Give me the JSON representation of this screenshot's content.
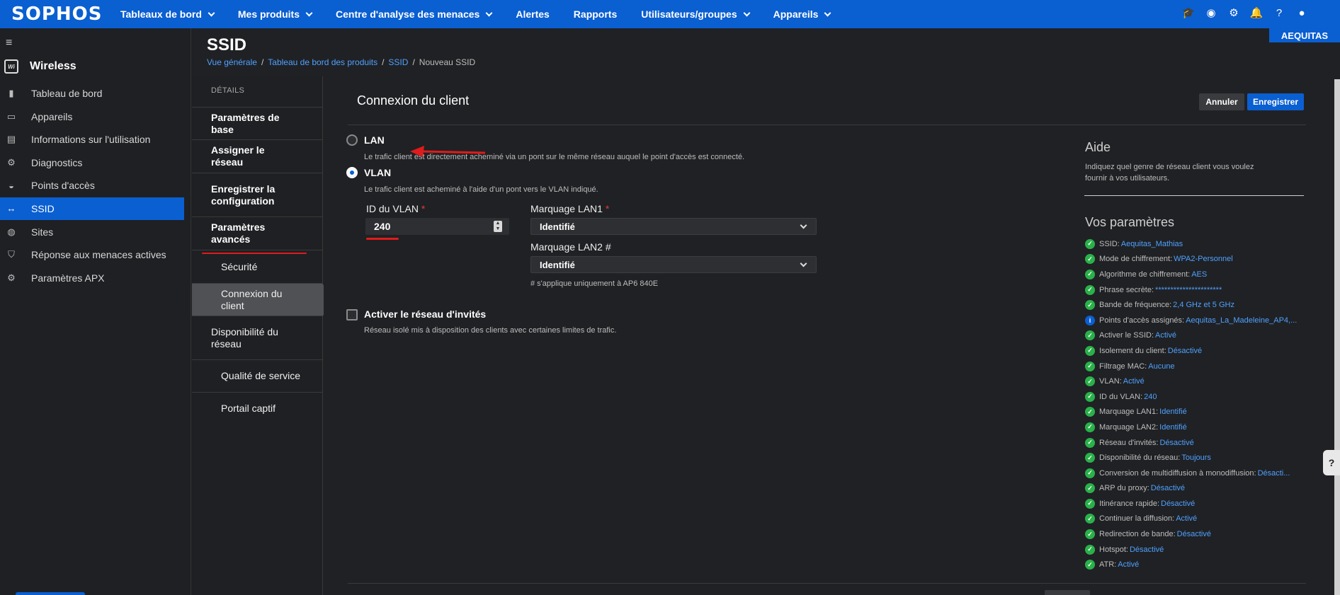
{
  "brand": {
    "logo": "SOPHOS",
    "tenant": "AEQUITAS"
  },
  "topnav": [
    {
      "label": "Tableaux de bord",
      "dropdown": true
    },
    {
      "label": "Mes produits",
      "dropdown": true
    },
    {
      "label": "Centre d'analyse des menaces",
      "dropdown": true
    },
    {
      "label": "Alertes",
      "dropdown": false
    },
    {
      "label": "Rapports",
      "dropdown": false
    },
    {
      "label": "Utilisateurs/groupes",
      "dropdown": true
    },
    {
      "label": "Appareils",
      "dropdown": true
    }
  ],
  "top_icons": [
    "graduation-cap-icon",
    "pulse-icon",
    "gear-icon",
    "bell-icon",
    "help-icon",
    "user-icon"
  ],
  "sidebar": {
    "app_badge": "Wi",
    "app_title": "Wireless",
    "items": [
      {
        "label": "Tableau de bord",
        "icon": "bar-chart-icon",
        "glyph": "▮"
      },
      {
        "label": "Appareils",
        "icon": "device-icon",
        "glyph": "▭"
      },
      {
        "label": "Informations sur l'utilisation",
        "icon": "clipboard-icon",
        "glyph": "▤"
      },
      {
        "label": "Diagnostics",
        "icon": "gear-icon",
        "glyph": "⚙"
      },
      {
        "label": "Points d'accès",
        "icon": "wifi-icon",
        "glyph": "◒"
      },
      {
        "label": "SSID",
        "icon": "arrows-icon",
        "glyph": "↔",
        "active": true
      },
      {
        "label": "Sites",
        "icon": "globe-icon",
        "glyph": "◍"
      },
      {
        "label": "Réponse aux menaces actives",
        "icon": "shield-icon",
        "glyph": "⛉"
      },
      {
        "label": "Paramètres APX",
        "icon": "gear-icon",
        "glyph": "⚙"
      }
    ]
  },
  "page": {
    "title": "SSID",
    "breadcrumb": [
      "Vue générale",
      "Tableau de bord des produits",
      "SSID"
    ],
    "breadcrumb_current": "Nouveau SSID"
  },
  "steps": {
    "header": "DÉTAILS",
    "items": [
      {
        "label": "Paramètres de base",
        "kind": "main"
      },
      {
        "label": "Assigner le réseau",
        "kind": "main"
      },
      {
        "label": "Enregistrer la configuration",
        "kind": "main"
      },
      {
        "label": "Paramètres avancés",
        "kind": "main"
      },
      {
        "label": "Sécurité",
        "kind": "sub"
      },
      {
        "label": "Connexion du client",
        "kind": "sub",
        "current": true
      },
      {
        "label": "Disponibilité du réseau",
        "kind": "sub"
      },
      {
        "label": "Qualité de service",
        "kind": "sub"
      },
      {
        "label": "Portail captif",
        "kind": "sub"
      }
    ]
  },
  "form": {
    "section_title": "Connexion du client",
    "cancel_label": "Annuler",
    "save_label": "Enregistrer",
    "lan_label": "LAN",
    "lan_desc": "Le trafic client est directement acheminé via un pont sur le même réseau auquel le point d'accès est connecté.",
    "vlan_label": "VLAN",
    "vlan_desc": "Le trafic client est acheminé à l'aide d'un pont vers le VLAN indiqué.",
    "selected": "VLAN",
    "vlan_id_label": "ID du VLAN",
    "vlan_id_value": "240",
    "lan1_label": "Marquage LAN1",
    "lan1_value": "Identifié",
    "lan2_label": "Marquage LAN2 #",
    "lan2_value": "Identifié",
    "lan2_hint": "# s'applique uniquement à AP6 840E",
    "guest_label": "Activer le réseau d'invités",
    "guest_desc": "Réseau isolé mis à disposition des clients avec certaines limites de trafic.",
    "guest_checked": false,
    "required_mark": "*"
  },
  "aside": {
    "help_title": "Aide",
    "help_text": "Indiquez quel genre de réseau client vous voulez fournir à vos utilisateurs.",
    "settings_title": "Vos paramètres",
    "settings": [
      {
        "label": "SSID:",
        "value": "Aequitas_Mathias",
        "status": "ok"
      },
      {
        "label": "Mode de chiffrement:",
        "value": "WPA2-Personnel",
        "status": "ok"
      },
      {
        "label": "Algorithme de chiffrement:",
        "value": "AES",
        "status": "ok"
      },
      {
        "label": "Phrase secrète:",
        "value": "**********************",
        "status": "ok"
      },
      {
        "label": "Bande de fréquence:",
        "value": "2,4 GHz et 5 GHz",
        "status": "ok"
      },
      {
        "label": "Points d'accès assignés:",
        "value": "Aequitas_La_Madeleine_AP4,...",
        "status": "info"
      },
      {
        "label": "Activer le SSID:",
        "value": "Activé",
        "status": "ok"
      },
      {
        "label": "Isolement du client:",
        "value": "Désactivé",
        "status": "ok"
      },
      {
        "label": "Filtrage MAC:",
        "value": "Aucune",
        "status": "ok"
      },
      {
        "label": "VLAN:",
        "value": "Activé",
        "status": "ok"
      },
      {
        "label": "ID du VLAN:",
        "value": "240",
        "status": "ok"
      },
      {
        "label": "Marquage LAN1:",
        "value": "Identifié",
        "status": "ok"
      },
      {
        "label": "Marquage LAN2:",
        "value": "Identifié",
        "status": "ok"
      },
      {
        "label": "Réseau d'invités:",
        "value": "Désactivé",
        "status": "ok"
      },
      {
        "label": "Disponibilité du réseau:",
        "value": "Toujours",
        "status": "ok"
      },
      {
        "label": "Conversion de multidiffusion à monodiffusion:",
        "value": "Désacti...",
        "status": "ok"
      },
      {
        "label": "ARP du proxy:",
        "value": "Désactivé",
        "status": "ok"
      },
      {
        "label": "Itinérance rapide:",
        "value": "Désactivé",
        "status": "ok"
      },
      {
        "label": "Continuer la diffusion:",
        "value": "Activé",
        "status": "ok"
      },
      {
        "label": "Redirection de bande:",
        "value": "Désactivé",
        "status": "ok"
      },
      {
        "label": "Hotspot:",
        "value": "Désactivé",
        "status": "ok"
      },
      {
        "label": "ATR:",
        "value": "Activé",
        "status": "ok"
      }
    ]
  },
  "colors": {
    "brand": "#0a5fd1",
    "accent_link": "#4ea1ff",
    "ok": "#2ab14a",
    "annotation": "#e01b1b"
  }
}
